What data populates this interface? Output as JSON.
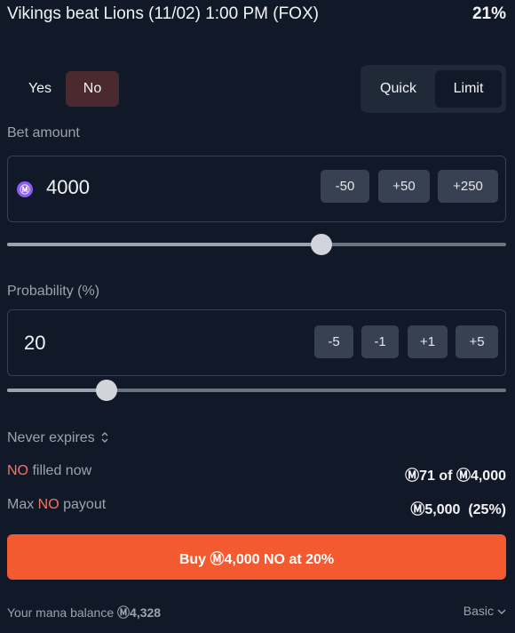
{
  "header": {
    "title": "Vikings beat Lions (11/02) 1:00 PM (FOX)",
    "probability": "21%"
  },
  "outcome": {
    "yes_label": "Yes",
    "no_label": "No",
    "selected": "No"
  },
  "mode": {
    "quick_label": "Quick",
    "limit_label": "Limit",
    "selected": "Limit"
  },
  "bet": {
    "label": "Bet amount",
    "currency_symbol": "Ⓜ",
    "value": "4000",
    "steps": [
      "-50",
      "+50",
      "+250"
    ],
    "slider_fraction": 0.63
  },
  "probability": {
    "label": "Probability (%)",
    "value": "20",
    "steps": [
      "-5",
      "-1",
      "+1",
      "+5"
    ],
    "slider_fraction": 0.2
  },
  "expires": {
    "label": "Never expires"
  },
  "filled": {
    "outcome": "NO",
    "label": " filled now",
    "value": "Ⓜ71 of Ⓜ4,000"
  },
  "payout": {
    "prefix": "Max ",
    "outcome": "NO",
    "label": " payout",
    "value": "Ⓜ5,000",
    "percent": "(25%)"
  },
  "buy_button": {
    "label": "Buy Ⓜ4,000 NO at 20%"
  },
  "footer": {
    "balance_label": "Your mana balance ",
    "balance_value": "Ⓜ4,328",
    "view_label": "Basic"
  },
  "colors": {
    "no_bg": "#4a2a2f",
    "accent": "#f45a2f",
    "no_text": "#f97362",
    "mana_icon": "#8b5cf6"
  }
}
